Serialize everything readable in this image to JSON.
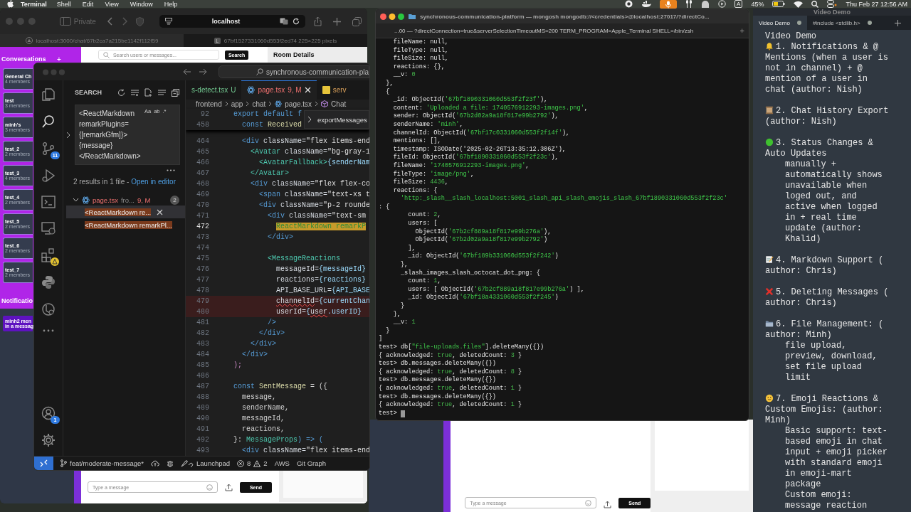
{
  "menubar": {
    "app": "Terminal",
    "menus": [
      "Shell",
      "Edit",
      "View",
      "Window",
      "Help"
    ],
    "input_source": "A",
    "battery": "45%",
    "clock": "Thu Feb 27  12:56 AM"
  },
  "browser": {
    "private_label": "Private",
    "address": "localhost",
    "tabs": [
      {
        "kind": "site",
        "title": "localhost:3000/chat/67b2ca7a215be1142f112f59",
        "selected": true
      },
      {
        "kind": "letter",
        "letter": "L",
        "title": "67bf1527331060d553f2ed74 225×225 pixels",
        "selected": false
      }
    ],
    "chat": {
      "sidebar_title": "Conversations",
      "add_label": "+",
      "channels": [
        {
          "name": "General Ch",
          "members": "4 members"
        },
        {
          "name": "test",
          "members": "3 members"
        },
        {
          "name": "minh's",
          "members": "3 members"
        },
        {
          "name": "test_2",
          "members": "2 members"
        },
        {
          "name": "test_3",
          "members": "4 members"
        },
        {
          "name": "test_4",
          "members": "2 members"
        },
        {
          "name": "test_5",
          "members": "2 members"
        },
        {
          "name": "test_6",
          "members": "2 members"
        },
        {
          "name": "test_7",
          "members": "2 members"
        }
      ],
      "notifications_title": "Notificatio",
      "notification_lines": [
        "minh2 men",
        "in a messag"
      ],
      "search_placeholder": "Search users or messages...",
      "search_button": "Search",
      "room_details": "Room Details",
      "message_placeholder": "Type a message",
      "send_button": "Send"
    }
  },
  "vscode": {
    "command_center": "synchronous-communication-pla",
    "search": {
      "title": "SEARCH",
      "query": "<ReactMarkdown remarkPlugins={[remarkGfm]}>{message}</ReactMarkdown>",
      "options": [
        "Aa",
        "ab",
        ".*"
      ],
      "summary": "2 results in 1 file - ",
      "open_link": "Open in editor",
      "file": {
        "name": "page.tsx",
        "path": "fro...",
        "status": "9, M",
        "count": "2"
      },
      "matches": [
        {
          "text": "<ReactMarkdown re...",
          "selected": true
        },
        {
          "text": "<ReactMarkdown remarkPl...",
          "selected": false
        }
      ]
    },
    "tabs": [
      {
        "kind": "untracked",
        "title": "s-detect.tsx",
        "status": "U",
        "selected": false
      },
      {
        "kind": "modified",
        "title": "page.tsx",
        "status": "9, M",
        "selected": true
      },
      {
        "kind": "js",
        "title": "serv",
        "selected": false
      }
    ],
    "breadcrumb": [
      "frontend",
      "app",
      "chat",
      "page.tsx",
      "Chat"
    ],
    "sticky": [
      {
        "number": "92",
        "parts": [
          {
            "text": "export default f",
            "kind": "kw"
          }
        ]
      },
      {
        "number": "458",
        "parts": [
          {
            "text": "  const",
            "kind": "kw"
          },
          {
            "text": " Received",
            "kind": "fn"
          }
        ]
      }
    ],
    "peek": "exportMessages",
    "lines": [
      {
        "number": "464",
        "kind": "plain",
        "parts": [
          {
            "text": "  <div",
            "kind": "tag"
          },
          {
            "text": " className=",
            "kind": "attr"
          },
          {
            "text": "\"flex items-end",
            "kind": "str"
          }
        ]
      },
      {
        "number": "465",
        "kind": "plain",
        "parts": [
          {
            "text": "    <Avatar",
            "kind": "comp"
          },
          {
            "text": " className=",
            "kind": "attr"
          },
          {
            "text": "\"bg-gray-1",
            "kind": "str"
          }
        ]
      },
      {
        "number": "466",
        "kind": "plain",
        "parts": [
          {
            "text": "      <AvatarFallback>",
            "kind": "comp"
          },
          {
            "text": "{senderNam",
            "kind": "expr"
          }
        ]
      },
      {
        "number": "467",
        "kind": "plain",
        "parts": [
          {
            "text": "    </Avatar>",
            "kind": "comp"
          }
        ]
      },
      {
        "number": "468",
        "kind": "plain",
        "parts": [
          {
            "text": "    <div",
            "kind": "tag"
          },
          {
            "text": " className=",
            "kind": "attr"
          },
          {
            "text": "\"flex flex-co",
            "kind": "str"
          }
        ]
      },
      {
        "number": "469",
        "kind": "plain",
        "parts": [
          {
            "text": "      <span",
            "kind": "tag"
          },
          {
            "text": " className=",
            "kind": "attr"
          },
          {
            "text": "\"text-xs t",
            "kind": "str"
          }
        ]
      },
      {
        "number": "470",
        "kind": "plain",
        "parts": [
          {
            "text": "      <div",
            "kind": "tag"
          },
          {
            "text": " className=",
            "kind": "attr"
          },
          {
            "text": "\"p-2 rounde",
            "kind": "str"
          }
        ]
      },
      {
        "number": "471",
        "kind": "plain",
        "parts": [
          {
            "text": "        <div",
            "kind": "tag"
          },
          {
            "text": " className=",
            "kind": "attr"
          },
          {
            "text": "\"text-sm",
            "kind": "str"
          }
        ]
      },
      {
        "number": "472",
        "kind": "current",
        "parts": [
          {
            "text": "          ReactMarkdown remarkP",
            "kind": "match"
          }
        ]
      },
      {
        "number": "473",
        "kind": "plain",
        "parts": [
          {
            "text": "        </div>",
            "kind": "tag"
          }
        ]
      },
      {
        "number": "474",
        "kind": "plain"
      },
      {
        "number": "475",
        "kind": "plain",
        "parts": [
          {
            "text": "        <MessageReactions",
            "kind": "comp"
          }
        ]
      },
      {
        "number": "476",
        "kind": "plain",
        "parts": [
          {
            "text": "          messageId=",
            "kind": "attr"
          },
          {
            "text": "{messageId}",
            "kind": "expr"
          }
        ]
      },
      {
        "number": "477",
        "kind": "plain",
        "parts": [
          {
            "text": "          reactions=",
            "kind": "attr"
          },
          {
            "text": "{reactions}",
            "kind": "expr"
          }
        ]
      },
      {
        "number": "478",
        "kind": "plain",
        "parts": [
          {
            "text": "          API_BASE_URL=",
            "kind": "attr"
          },
          {
            "text": "{API_BASE",
            "kind": "expr"
          }
        ]
      },
      {
        "number": "479",
        "kind": "error",
        "parts": [
          {
            "text": "          channelId",
            "kind": "err"
          },
          {
            "text": "=",
            "kind": "attr"
          },
          {
            "text": "{currentChan",
            "kind": "expr"
          }
        ]
      },
      {
        "number": "480",
        "kind": "error",
        "parts": [
          {
            "text": "          userId=",
            "kind": "attr"
          },
          {
            "text": "{",
            "kind": "expr"
          },
          {
            "text": "user",
            "kind": "err"
          },
          {
            "text": ".userID}",
            "kind": "expr"
          }
        ]
      },
      {
        "number": "481",
        "kind": "plain",
        "parts": [
          {
            "text": "        />",
            "kind": "tag"
          }
        ]
      },
      {
        "number": "482",
        "kind": "plain",
        "parts": [
          {
            "text": "      </div>",
            "kind": "tag"
          }
        ]
      },
      {
        "number": "483",
        "kind": "plain",
        "parts": [
          {
            "text": "    </div>",
            "kind": "tag"
          }
        ]
      },
      {
        "number": "484",
        "kind": "plain",
        "parts": [
          {
            "text": "  </div>",
            "kind": "tag"
          }
        ]
      },
      {
        "number": "485",
        "kind": "plain",
        "parts": [
          {
            "text": ");",
            "kind": "brace"
          }
        ]
      },
      {
        "number": "486",
        "kind": "plain"
      },
      {
        "number": "487",
        "kind": "plain",
        "parts": [
          {
            "text": "const",
            "kind": "kw"
          },
          {
            "text": " SentMessage",
            "kind": "fn"
          },
          {
            "text": " = ({",
            "kind": "text"
          }
        ]
      },
      {
        "number": "488",
        "kind": "plain",
        "parts": [
          {
            "text": "  message,",
            "kind": "text"
          }
        ]
      },
      {
        "number": "489",
        "kind": "plain",
        "parts": [
          {
            "text": "  senderName,",
            "kind": "text"
          }
        ]
      },
      {
        "number": "490",
        "kind": "plain",
        "parts": [
          {
            "text": "  messageId,",
            "kind": "text"
          }
        ]
      },
      {
        "number": "491",
        "kind": "plain",
        "parts": [
          {
            "text": "  reactions,",
            "kind": "text"
          }
        ]
      },
      {
        "number": "492",
        "kind": "plain",
        "parts": [
          {
            "text": "}: ",
            "kind": "text"
          },
          {
            "text": "MessageProps",
            "kind": "comp"
          },
          {
            "text": ") => (",
            "kind": "kw"
          }
        ]
      },
      {
        "number": "493",
        "kind": "plain",
        "parts": [
          {
            "text": "  <div",
            "kind": "tag"
          },
          {
            "text": " className=",
            "kind": "attr"
          },
          {
            "text": "\"flex items-end",
            "kind": "str"
          }
        ]
      }
    ],
    "status": {
      "branch": "feat/moderate-message*",
      "launchpad": "Launchpad",
      "errors": "8",
      "warnings": "2",
      "aws": "AWS",
      "git_graph": "Git Graph"
    },
    "badges": {
      "source_control": "11",
      "accounts": "1"
    }
  },
  "terminal": {
    "title": "synchronous-communication-platform — mongosh mongodb://<credentials>@localhost:27017/?directCo...",
    "tab": "...00 — ?directConnection=true&serverSelectionTimeoutMS=200 TERM_PROGRAM=Apple_Terminal SHELL=/bin/zsh",
    "new_tab": "+",
    "cursor": true,
    "lines": [
      [
        {
          "text": "    fileName: null,",
          "kind": "plain"
        }
      ],
      [
        {
          "text": "    fileType: null,",
          "kind": "plain"
        }
      ],
      [
        {
          "text": "    fileSize: null,",
          "kind": "plain"
        }
      ],
      [
        {
          "text": "    reactions: {},",
          "kind": "plain"
        }
      ],
      [
        {
          "text": "    __v: ",
          "kind": "plain"
        },
        {
          "text": "0",
          "kind": "num"
        }
      ],
      [
        {
          "text": "  },",
          "kind": "plain"
        }
      ],
      [
        {
          "text": "  {",
          "kind": "plain"
        }
      ],
      [
        {
          "text": "    _id: ObjectId(",
          "kind": "plain"
        },
        {
          "text": "'67bf1890331060d553f2f23f'",
          "kind": "str"
        },
        {
          "text": "),",
          "kind": "plain"
        }
      ],
      [
        {
          "text": "    content: ",
          "kind": "plain"
        },
        {
          "text": "'Uploaded a file: 1740576912293-images.png'",
          "kind": "str"
        },
        {
          "text": ",",
          "kind": "plain"
        }
      ],
      [
        {
          "text": "    sender: ObjectId(",
          "kind": "plain"
        },
        {
          "text": "'67b2d02a9a18f817e99b2792'",
          "kind": "str"
        },
        {
          "text": "),",
          "kind": "plain"
        }
      ],
      [
        {
          "text": "    senderName: ",
          "kind": "plain"
        },
        {
          "text": "'minh'",
          "kind": "str"
        },
        {
          "text": ",",
          "kind": "plain"
        }
      ],
      [
        {
          "text": "    channelId: ObjectId(",
          "kind": "plain"
        },
        {
          "text": "'67bf17c0331060d553f2f14f'",
          "kind": "str"
        },
        {
          "text": "),",
          "kind": "plain"
        }
      ],
      [
        {
          "text": "    mentions: [],",
          "kind": "plain"
        }
      ],
      [
        {
          "text": "    timestamp: ISODate('2025-02-26T13:35:12.306Z'),",
          "kind": "plain"
        }
      ],
      [
        {
          "text": "    fileId: ObjectId(",
          "kind": "plain"
        },
        {
          "text": "'67bf1890331060d553f2f23c'",
          "kind": "str"
        },
        {
          "text": "),",
          "kind": "plain"
        }
      ],
      [
        {
          "text": "    fileName: ",
          "kind": "plain"
        },
        {
          "text": "'1740576912293-images.png'",
          "kind": "str"
        },
        {
          "text": ",",
          "kind": "plain"
        }
      ],
      [
        {
          "text": "    fileType: ",
          "kind": "plain"
        },
        {
          "text": "'image/png'",
          "kind": "str"
        },
        {
          "text": ",",
          "kind": "plain"
        }
      ],
      [
        {
          "text": "    fileSize: ",
          "kind": "plain"
        },
        {
          "text": "4436",
          "kind": "num"
        },
        {
          "text": ",",
          "kind": "plain"
        }
      ],
      [
        {
          "text": "    reactions: {",
          "kind": "plain"
        }
      ],
      [
        {
          "text": "      'http:_slash__slash_localhost:5001_slash_api_slash_emojis_slash_67bf1890331060d553f2f23c'",
          "kind": "str"
        }
      ],
      [
        {
          "text": ": {",
          "kind": "plain"
        }
      ],
      [
        {
          "text": "        count: ",
          "kind": "plain"
        },
        {
          "text": "2",
          "kind": "num"
        },
        {
          "text": ",",
          "kind": "plain"
        }
      ],
      [
        {
          "text": "        users: [",
          "kind": "plain"
        }
      ],
      [
        {
          "text": "          ObjectId(",
          "kind": "plain"
        },
        {
          "text": "'67b2cf889a18f817e99b276a'",
          "kind": "str"
        },
        {
          "text": "),",
          "kind": "plain"
        }
      ],
      [
        {
          "text": "          ObjectId(",
          "kind": "plain"
        },
        {
          "text": "'67b2d02a9a18f817e99b2792'",
          "kind": "str"
        },
        {
          "text": ")",
          "kind": "plain"
        }
      ],
      [
        {
          "text": "        ],",
          "kind": "plain"
        }
      ],
      [
        {
          "text": "        _id: ObjectId(",
          "kind": "plain"
        },
        {
          "text": "'67bf189b331060d553f2f242'",
          "kind": "str"
        },
        {
          "text": ")",
          "kind": "plain"
        }
      ],
      [
        {
          "text": "      },",
          "kind": "plain"
        }
      ],
      [
        {
          "text": "      _slash_images_slash_octocat_dot_png: {",
          "kind": "plain"
        }
      ],
      [
        {
          "text": "        count: ",
          "kind": "plain"
        },
        {
          "text": "1",
          "kind": "num"
        },
        {
          "text": ",",
          "kind": "plain"
        }
      ],
      [
        {
          "text": "        users: [ ObjectId(",
          "kind": "plain"
        },
        {
          "text": "'67b2cf889a18f817e99b276a'",
          "kind": "str"
        },
        {
          "text": ") ],",
          "kind": "plain"
        }
      ],
      [
        {
          "text": "        _id: ObjectId(",
          "kind": "plain"
        },
        {
          "text": "'67bf18a4331060d553f2f245'",
          "kind": "str"
        },
        {
          "text": ")",
          "kind": "plain"
        }
      ],
      [
        {
          "text": "      }",
          "kind": "plain"
        }
      ],
      [
        {
          "text": "    },",
          "kind": "plain"
        }
      ],
      [
        {
          "text": "    __v: ",
          "kind": "plain"
        },
        {
          "text": "1",
          "kind": "num"
        }
      ],
      [
        {
          "text": "  }",
          "kind": "plain"
        }
      ],
      [
        {
          "text": "]",
          "kind": "plain"
        }
      ],
      [
        {
          "text": "test> db[",
          "kind": "plain"
        },
        {
          "text": "\"file-uploads.files\"",
          "kind": "str"
        },
        {
          "text": "].deleteMany({})",
          "kind": "plain"
        }
      ],
      [
        {
          "text": "{ acknowledged: ",
          "kind": "plain"
        },
        {
          "text": "true",
          "kind": "num"
        },
        {
          "text": ", deletedCount: ",
          "kind": "plain"
        },
        {
          "text": "3",
          "kind": "num"
        },
        {
          "text": " }",
          "kind": "plain"
        }
      ],
      [
        {
          "text": "test> db.messages.deleteMany({})",
          "kind": "plain"
        }
      ],
      [
        {
          "text": "{ acknowledged: ",
          "kind": "plain"
        },
        {
          "text": "true",
          "kind": "num"
        },
        {
          "text": ", deletedCount: ",
          "kind": "plain"
        },
        {
          "text": "8",
          "kind": "num"
        },
        {
          "text": " }",
          "kind": "plain"
        }
      ],
      [
        {
          "text": "test> db.messages.deleteMany({})",
          "kind": "plain"
        }
      ],
      [
        {
          "text": "{ acknowledged: ",
          "kind": "plain"
        },
        {
          "text": "true",
          "kind": "num"
        },
        {
          "text": ", deletedCount: ",
          "kind": "plain"
        },
        {
          "text": "1",
          "kind": "num"
        },
        {
          "text": " }",
          "kind": "plain"
        }
      ],
      [
        {
          "text": "test> db.messages.deleteMany({})",
          "kind": "plain"
        }
      ],
      [
        {
          "text": "{ acknowledged: ",
          "kind": "plain"
        },
        {
          "text": "true",
          "kind": "num"
        },
        {
          "text": ", deletedCount: ",
          "kind": "plain"
        },
        {
          "text": "1",
          "kind": "num"
        },
        {
          "text": " }",
          "kind": "plain"
        }
      ],
      [
        {
          "text": "test> ",
          "kind": "plain"
        }
      ]
    ]
  },
  "notes": {
    "title": "Video Demo",
    "tabs": [
      {
        "title": "Video Demo",
        "selected": true
      },
      {
        "title": "#include <stdlib.h>",
        "selected": false
      }
    ],
    "heading": "Video Demo",
    "items": [
      {
        "kind": "bell",
        "title": "1. Notifications & @ Mentions (when a user is not in channel) + @ mention of a user in chat (author: Nish)"
      },
      {
        "kind": "scroll",
        "title": "2. Chat History Export (author: Nish)"
      },
      {
        "kind": "green-circle",
        "title": "3. Status Changes & Auto Updates",
        "details": [
          "manually + automatically shows unavailable when loged out, and active when logged in + real time update (author: Khalid)"
        ]
      },
      {
        "kind": "memo",
        "title": "4. Markdown Support ( author: Chris)"
      },
      {
        "kind": "cross",
        "title": "5. Deleting Messages ( author: Chris)"
      },
      {
        "kind": "folder",
        "title": "6. File Management: ( author: Minh)",
        "details": [
          "file upload, preview, download, set file upload limit"
        ]
      },
      {
        "kind": "smiley",
        "title": "7. Emoji Reactions & Custom Emojis: (author: Minh)",
        "details": [
          "Basic support: text-based emoji in chat input + emoji picker with standard emoji in emoji-mart package",
          "Custom emoji: message reaction"
        ]
      }
    ]
  },
  "chat2": {
    "message_placeholder": "Type a message",
    "send_button": "Send"
  }
}
